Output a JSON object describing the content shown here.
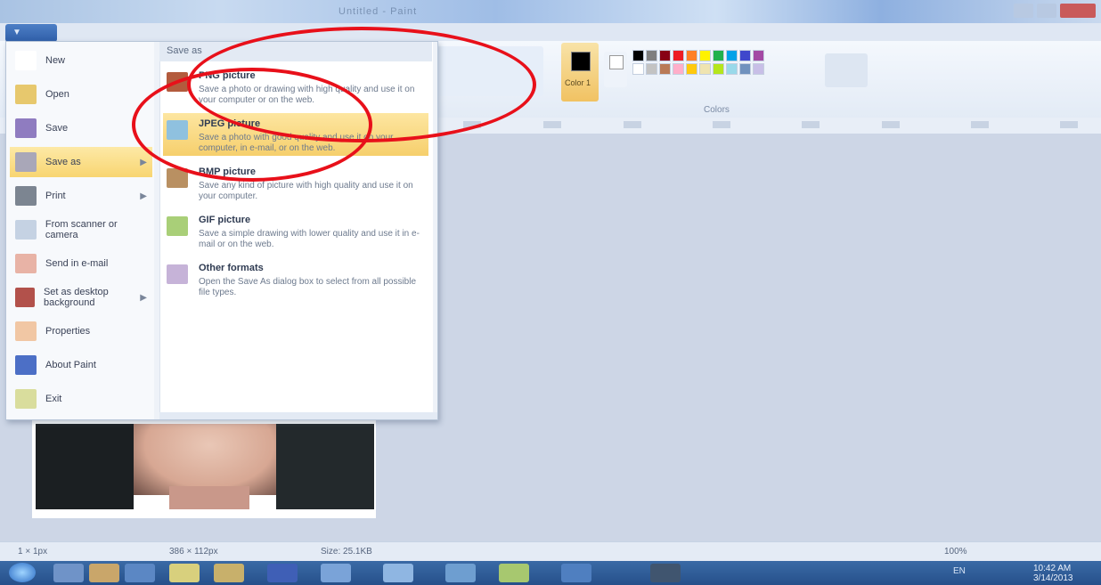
{
  "window": {
    "title": "Untitled - Paint",
    "controls": {
      "minimize": "–",
      "maximize": "□",
      "close": "✕"
    }
  },
  "app_button": {
    "label": "▼"
  },
  "ribbon": {
    "color1_label": "Color 1",
    "colors_group_label": "Colors",
    "palette_row1": [
      "#000000",
      "#7f7f7f",
      "#880015",
      "#ed1c24",
      "#ff7f27",
      "#fff200",
      "#22b14c",
      "#00a2e8",
      "#3f48cc",
      "#a349a4"
    ],
    "palette_row2": [
      "#ffffff",
      "#c3c3c3",
      "#b97a57",
      "#ffaec9",
      "#ffc90e",
      "#efe4b0",
      "#b5e61d",
      "#99d9ea",
      "#7092be",
      "#c8bfe7"
    ]
  },
  "menu": {
    "left_items": [
      {
        "label": "New",
        "icon": "new-file-icon",
        "color": "#ffffff"
      },
      {
        "label": "Open",
        "icon": "open-folder-icon",
        "color": "#e7c86d"
      },
      {
        "label": "Save",
        "icon": "save-disk-icon",
        "color": "#8f7cc0"
      },
      {
        "label": "Save as",
        "icon": "save-as-icon",
        "color": "#a9a7b8",
        "selected": true,
        "arrow": "▶"
      },
      {
        "label": "Print",
        "icon": "printer-icon",
        "color": "#7c8591",
        "arrow": "▶"
      },
      {
        "label": "From scanner or camera",
        "icon": "scanner-icon",
        "color": "#c5d2e3"
      },
      {
        "label": "Send in e-mail",
        "icon": "email-icon",
        "color": "#e8b3a6"
      },
      {
        "label": "Set as desktop background",
        "icon": "desktop-background-icon",
        "color": "#b2514b",
        "arrow": "▶"
      },
      {
        "label": "Properties",
        "icon": "properties-icon",
        "color": "#f1c7a4"
      },
      {
        "label": "About Paint",
        "icon": "about-icon",
        "color": "#4c6fc6"
      },
      {
        "label": "Exit",
        "icon": "exit-icon",
        "color": "#d9dd9d"
      }
    ],
    "right_header": "Save as",
    "right_items": [
      {
        "title": "PNG picture",
        "desc": "Save a photo or drawing with high quality and use it on your computer or on the web.",
        "icon": "png-icon",
        "color": "#b35b3d"
      },
      {
        "title": "JPEG picture",
        "desc": "Save a photo with good quality and use it on your computer, in e-mail, or on the web.",
        "icon": "jpeg-icon",
        "color": "#8fc1df",
        "selected": true
      },
      {
        "title": "BMP picture",
        "desc": "Save any kind of picture with high quality and use it on your computer.",
        "icon": "bmp-icon",
        "color": "#b99062"
      },
      {
        "title": "GIF picture",
        "desc": "Save a simple drawing with lower quality and use it in e-mail or on the web.",
        "icon": "gif-icon",
        "color": "#a9cf78"
      },
      {
        "title": "Other formats",
        "desc": "Open the Save As dialog box to select from all possible file types.",
        "icon": "other-formats-icon",
        "color": "#c6b3d8"
      }
    ]
  },
  "statusbar": {
    "position": "1 × 1px",
    "size": "386 × 112px",
    "file_size": "Size: 25.1KB",
    "zoom": "100%"
  },
  "taskbar": {
    "tray_text": "EN",
    "time": "10:42 AM",
    "date": "3/14/2013"
  }
}
